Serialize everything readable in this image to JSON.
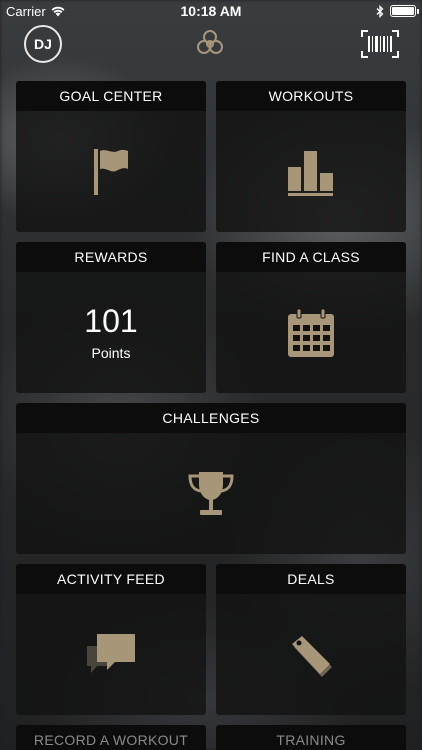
{
  "status_bar": {
    "carrier": "Carrier",
    "time": "10:18 AM"
  },
  "nav": {
    "avatar_initials": "DJ",
    "logo_icon": "knot-logo-icon",
    "barcode_icon": "barcode-scan-icon"
  },
  "tiles": {
    "goal_center": {
      "label": "GOAL CENTER",
      "icon": "flag-icon"
    },
    "workouts": {
      "label": "WORKOUTS",
      "icon": "bar-chart-icon"
    },
    "rewards": {
      "label": "REWARDS",
      "points_value": "101",
      "points_label": "Points"
    },
    "find_a_class": {
      "label": "FIND A CLASS",
      "icon": "calendar-icon"
    },
    "challenges": {
      "label": "CHALLENGES",
      "icon": "trophy-icon"
    },
    "activity_feed": {
      "label": "ACTIVITY FEED",
      "icon": "chat-bubbles-icon"
    },
    "deals": {
      "label": "DEALS",
      "icon": "price-tag-icon"
    },
    "record_a_workout": {
      "label": "RECORD A WORKOUT"
    },
    "training": {
      "label": "TRAINING"
    }
  },
  "colors": {
    "accent_gold": "#a89679",
    "tile_bg": "#121212",
    "header_bg": "#0c0c0c"
  }
}
